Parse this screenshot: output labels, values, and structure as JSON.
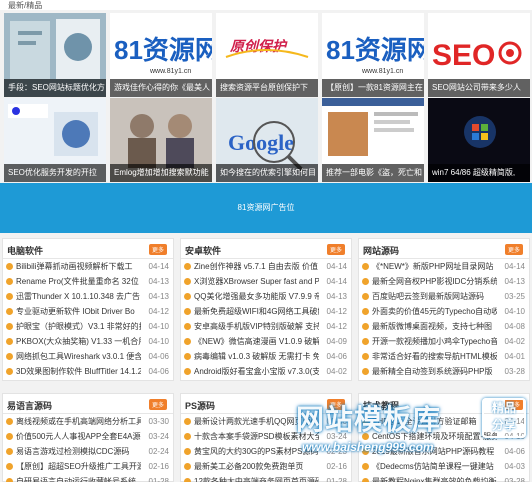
{
  "topbar": {
    "title": "最新/精品"
  },
  "tiles": [
    {
      "caption": "手段：SEO网站标题优化方"
    },
    {
      "caption": "游戏佳作心得的你《最美人"
    },
    {
      "caption": "搜索资源平台原创保护下"
    },
    {
      "caption": "【原创】一款81资源网主在"
    },
    {
      "caption": "SEO网站公司带来多少人"
    },
    {
      "caption": "SEO优化服务开发的开拉"
    },
    {
      "caption": "Emlog增加增加搜索默功能"
    },
    {
      "caption": "如今搜在的优索引擎如何目"
    },
    {
      "caption": "推荐一部电影《盗，死亡和"
    },
    {
      "caption": "win7 64/86 超级精简版,"
    }
  ],
  "tile_art": {
    "t2": "81资源网",
    "t2sub": "www.81y1.cn",
    "t3": "原创保护",
    "t4": "81资源网",
    "t4sub": "www.81y1.cn",
    "t5": "SEO",
    "t7": "Google"
  },
  "ad": {
    "text": "81资源网广告位"
  },
  "panels": [
    {
      "title": "电脑软件",
      "more": "更多",
      "rows": [
        {
          "t": "Bilibili弹幕抓动画视频解析下载工",
          "d": "04-14"
        },
        {
          "t": "Rename Pro(文件批量重命名 32位 6",
          "d": "04-13"
        },
        {
          "t": "迅雷Thunder X 10.1.10.348 去广告",
          "d": "04-13"
        },
        {
          "t": "专业驱动更新软件 IObit Driver Bo",
          "d": "04-12"
        },
        {
          "t": "护眼宝（护眼模式）V3.1 非常好的护",
          "d": "04-10"
        },
        {
          "t": "PKBOX(大众抽奖箱) V1.33 一机合用",
          "d": "04-10"
        },
        {
          "t": "网络抓包工具Wireshark v3.0.1 便含",
          "d": "04-06"
        },
        {
          "t": "3D效果图制作软件 BluffTitler 14.1.2.",
          "d": "04-06"
        }
      ]
    },
    {
      "title": "安卓软件",
      "more": "更多",
      "rows": [
        {
          "t": "Zine创作神器 v5.7.1 自由去版 价值",
          "d": "04-14"
        },
        {
          "t": "X浏览器XBrowser Super fast and P",
          "d": "04-14"
        },
        {
          "t": "QQ美化增强最女多功能版 V7.9.9 帝",
          "d": "04-13"
        },
        {
          "t": "最新免费超级WIFI和4G网络工具破解",
          "d": "04-12"
        },
        {
          "t": "安卓高级手机版VIP特别版破解 支持",
          "d": "04-12"
        },
        {
          "t": "《NEW》微信高速漫画 V1.0.9 破解版",
          "d": "04-09"
        },
        {
          "t": "病毒编辑 v1.0.3 破解版 无需打卡 免",
          "d": "04-06"
        },
        {
          "t": "Android版好看宝盒小宝版 v7.3.0(支",
          "d": "04-02"
        }
      ]
    },
    {
      "title": "网站源码",
      "more": "更多",
      "rows": [
        {
          "t": "《*NEW*》新版PHP网址目录网站",
          "d": "04-14"
        },
        {
          "t": "最新全网音权PHP影视IDC分销系统",
          "d": "04-13"
        },
        {
          "t": "百度贴吧云签到最新版网站源码",
          "d": "03-25"
        },
        {
          "t": "外面卖的价值45元的Typecho自动收",
          "d": "04-10"
        },
        {
          "t": "最新版微博桌面视频，支持七种图",
          "d": "04-08"
        },
        {
          "t": "开源一款视频播加小鸡伞Typecho音",
          "d": "04-02"
        },
        {
          "t": "非常适合好看的搜索导航HTML模板",
          "d": "04-01"
        },
        {
          "t": "最新精全自动签到系统源码PHP版",
          "d": "03-28"
        }
      ]
    },
    {
      "title": "易语言源码",
      "more": "更多",
      "rows": [
        {
          "t": "离线视频或在手机高端网络分析工具",
          "d": "03-30"
        },
        {
          "t": "价值500元人人事视APP全套E4A源码",
          "d": "03-24"
        },
        {
          "t": "易语言游戏过检测模拟CDC源码",
          "d": "02-24"
        },
        {
          "t": "【原创】超超SEO升级推广工具开源",
          "d": "02-16"
        },
        {
          "t": "自研易语言自动运行收藏帐号系统",
          "d": "01-28"
        }
      ]
    },
    {
      "title": "PS源码",
      "more": "更多",
      "rows": [
        {
          "t": "最新设计两款光速手机QQ网页源码",
          "d": "03-30"
        },
        {
          "t": "十款含本案手袋源PSD模板素材大全",
          "d": "03-24"
        },
        {
          "t": "黄宝风的大约30G的PS素材PS源码",
          "d": "02-23"
        },
        {
          "t": "最新美工必备200款免费跑单页",
          "d": "02-16"
        },
        {
          "t": "12款各种大中高端商务网页首页源码",
          "d": "01-28"
        }
      ]
    },
    {
      "title": "技术教程",
      "more": "更多",
      "rows": [
        {
          "t": "PHP怎么全设置对方验证邮箱",
          "d": "04-14"
        },
        {
          "t": "CentOS下搭建环境及环境配置-服务",
          "d": "04-10"
        },
        {
          "t": "2019最新版音乐网站PHP源码教程",
          "d": "04-06"
        },
        {
          "t": "《Dedecms仿站简单课程一键建站",
          "d": "04-03"
        },
        {
          "t": "最新教程Nginx集群高效的负载均衡",
          "d": "03-28"
        }
      ]
    }
  ],
  "watermark": {
    "main": "网站模板库",
    "url": "www.baisheng999.com",
    "badge_1": "精品",
    "badge_2": "分享"
  },
  "colors": {
    "accent": "#1e9ad6",
    "more": "#f07f2b",
    "icon": "#f0a32b"
  }
}
